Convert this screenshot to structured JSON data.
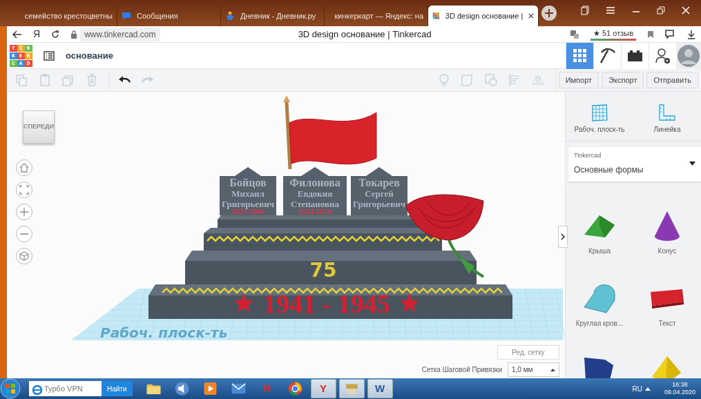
{
  "browser": {
    "tabs": [
      {
        "title": "семейство крестоцветны",
        "kind": "yandex",
        "selected": false
      },
      {
        "title": "Сообщения",
        "kind": "chat",
        "selected": false
      },
      {
        "title": "Дневник - Дневник.ру",
        "kind": "diary",
        "selected": false
      },
      {
        "title": "кинкеркарт — Яндекс: на",
        "kind": "yandex",
        "selected": false
      },
      {
        "title": "3D design основание |",
        "kind": "tinkercad",
        "selected": true
      }
    ],
    "home_glyph": "Я",
    "address": "www.tinkercad.com",
    "page_title": "3D design основание | Tinkercad",
    "reviews": "★ 51 отзыв"
  },
  "app": {
    "logo_rows": [
      "TIN",
      "KER",
      "CAD"
    ],
    "design_name": "основание",
    "view_modes": [
      {
        "kind": "grid",
        "selected": true
      },
      {
        "kind": "pickaxe",
        "selected": false
      },
      {
        "kind": "bricks",
        "selected": false
      }
    ],
    "toolbar_icons": [
      {
        "kind": "copy",
        "disabled": true
      },
      {
        "kind": "paste",
        "disabled": true
      },
      {
        "kind": "duplicate",
        "disabled": true
      },
      {
        "kind": "trash",
        "disabled": true
      },
      {
        "kind": "undo",
        "disabled": false
      },
      {
        "kind": "redo",
        "disabled": true
      }
    ],
    "tool_icons": [
      {
        "kind": "bulb",
        "disabled": true
      },
      {
        "kind": "note",
        "disabled": true
      },
      {
        "kind": "group",
        "disabled": true
      },
      {
        "kind": "align",
        "disabled": true
      },
      {
        "kind": "mirror",
        "disabled": true
      }
    ],
    "actions": [
      "Импорт",
      "Экспорт",
      "Отправить"
    ]
  },
  "viewport": {
    "view_cube": "СПЕРЕДИ",
    "plaques": [
      {
        "lines": [
          "Бойцов",
          "Михаил",
          "Григорьевич"
        ],
        "years": "1927-2006"
      },
      {
        "lines": [
          "Филонова",
          "Евдокия",
          "Степановна"
        ],
        "years": "1924-2010"
      },
      {
        "lines": [
          "Токарев",
          "Сергей",
          "Григорьевич"
        ]
      }
    ],
    "number": "75",
    "years": "1941 - 1945",
    "workplane_label": "Рабоч. плоск-ть",
    "edit_grid": "Ред. сетку",
    "snap_label": "Сетка Шаговой Привязки",
    "snap_value": "1,0 мм"
  },
  "panel": {
    "tools": [
      {
        "kind": "workplane",
        "label": "Рабоч. плоск-ть"
      },
      {
        "kind": "ruler",
        "label": "Линейка"
      }
    ],
    "library_group": "Tinkercad",
    "library": "Основные формы",
    "shapes": [
      {
        "kind": "roof",
        "label": "Крыша"
      },
      {
        "kind": "cone",
        "label": "Конус"
      },
      {
        "kind": "round-roof",
        "label": "Круглая кров..."
      },
      {
        "kind": "text",
        "label": "Текст"
      },
      {
        "kind": "box"
      },
      {
        "kind": "pyramid"
      }
    ]
  },
  "taskbar": {
    "search_placeholder": "Турбо VPN",
    "search_button": "Найти",
    "apps": [
      {
        "kind": "folder",
        "open": false
      },
      {
        "kind": "speaker",
        "open": false
      },
      {
        "kind": "media",
        "open": false
      },
      {
        "kind": "mail",
        "open": false
      },
      {
        "kind": "yandex",
        "glyph": "Я",
        "open": false
      },
      {
        "kind": "chrome",
        "open": false
      },
      {
        "kind": "yabrowser",
        "glyph": "Y",
        "open": true
      },
      {
        "kind": "game",
        "open": true
      },
      {
        "kind": "word",
        "glyph": "W",
        "open": true
      }
    ],
    "language": "RU",
    "time": "16:38",
    "date": "09.04.2020"
  }
}
